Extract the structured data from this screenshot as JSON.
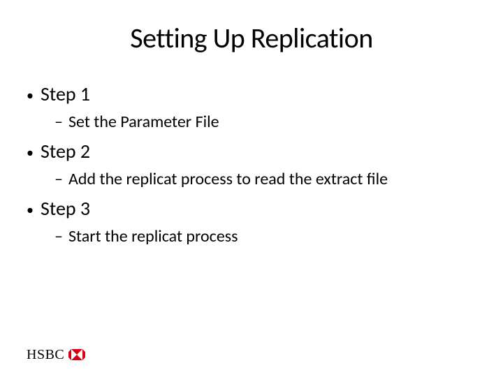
{
  "title": "Setting Up Replication",
  "steps": [
    {
      "label": "Step 1",
      "sub": "Set the Parameter File"
    },
    {
      "label": "Step 2",
      "sub": "Add the replicat process to read the extract file"
    },
    {
      "label": "Step 3",
      "sub": "Start the replicat process"
    }
  ],
  "logo": {
    "text": "HSBC",
    "color": "#db0011"
  }
}
